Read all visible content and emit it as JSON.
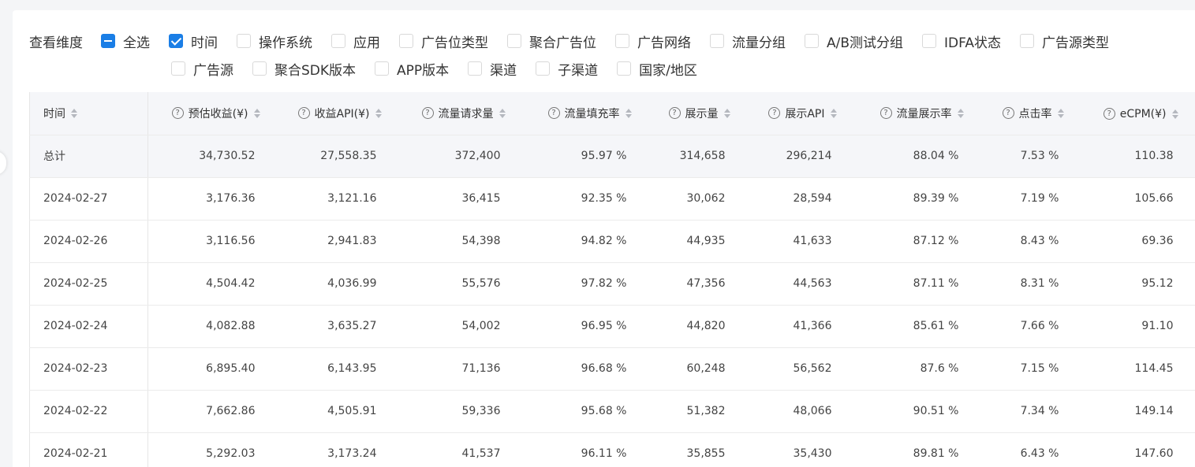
{
  "dimension_selector": {
    "label": "查看维度",
    "row1": [
      {
        "label": "全选",
        "state": "indeterminate"
      },
      {
        "label": "时间",
        "state": "checked"
      },
      {
        "label": "操作系统",
        "state": "unchecked"
      },
      {
        "label": "应用",
        "state": "unchecked"
      },
      {
        "label": "广告位类型",
        "state": "unchecked"
      },
      {
        "label": "聚合广告位",
        "state": "unchecked"
      },
      {
        "label": "广告网络",
        "state": "unchecked"
      },
      {
        "label": "流量分组",
        "state": "unchecked"
      },
      {
        "label": "A/B测试分组",
        "state": "unchecked"
      },
      {
        "label": "IDFA状态",
        "state": "unchecked"
      },
      {
        "label": "广告源类型",
        "state": "unchecked"
      }
    ],
    "row2": [
      {
        "label": "广告源",
        "state": "unchecked"
      },
      {
        "label": "聚合SDK版本",
        "state": "unchecked"
      },
      {
        "label": "APP版本",
        "state": "unchecked"
      },
      {
        "label": "渠道",
        "state": "unchecked"
      },
      {
        "label": "子渠道",
        "state": "unchecked"
      },
      {
        "label": "国家/地区",
        "state": "unchecked"
      }
    ]
  },
  "table": {
    "columns": [
      {
        "label": "时间",
        "help": false
      },
      {
        "label": "预估收益(¥)",
        "help": true
      },
      {
        "label": "收益API(¥)",
        "help": true
      },
      {
        "label": "流量请求量",
        "help": true
      },
      {
        "label": "流量填充率",
        "help": true
      },
      {
        "label": "展示量",
        "help": true
      },
      {
        "label": "展示API",
        "help": true
      },
      {
        "label": "流量展示率",
        "help": true
      },
      {
        "label": "点击率",
        "help": true
      },
      {
        "label": "eCPM(¥)",
        "help": true
      }
    ],
    "total": [
      "总计",
      "34,730.52",
      "27,558.35",
      "372,400",
      "95.97 %",
      "314,658",
      "296,214",
      "88.04 %",
      "7.53 %",
      "110.38"
    ],
    "rows": [
      [
        "2024-02-27",
        "3,176.36",
        "3,121.16",
        "36,415",
        "92.35 %",
        "30,062",
        "28,594",
        "89.39 %",
        "7.19 %",
        "105.66"
      ],
      [
        "2024-02-26",
        "3,116.56",
        "2,941.83",
        "54,398",
        "94.82 %",
        "44,935",
        "41,633",
        "87.12 %",
        "8.43 %",
        "69.36"
      ],
      [
        "2024-02-25",
        "4,504.42",
        "4,036.99",
        "55,576",
        "97.82 %",
        "47,356",
        "44,563",
        "87.11 %",
        "8.31 %",
        "95.12"
      ],
      [
        "2024-02-24",
        "4,082.88",
        "3,635.27",
        "54,002",
        "96.95 %",
        "44,820",
        "41,366",
        "85.61 %",
        "7.66 %",
        "91.10"
      ],
      [
        "2024-02-23",
        "6,895.40",
        "6,143.95",
        "71,136",
        "96.68 %",
        "60,248",
        "56,562",
        "87.6 %",
        "7.15 %",
        "114.45"
      ],
      [
        "2024-02-22",
        "7,662.86",
        "4,505.91",
        "59,336",
        "95.68 %",
        "51,382",
        "48,066",
        "90.51 %",
        "7.34 %",
        "149.14"
      ],
      [
        "2024-02-21",
        "5,292.03",
        "3,173.24",
        "41,537",
        "96.11 %",
        "35,855",
        "35,430",
        "89.81 %",
        "6.43 %",
        "147.60"
      ]
    ]
  },
  "colors": {
    "checkbox_active": "#1a7ee6",
    "header_bg": "#f5f6f9",
    "page_bg": "#f4f5f7"
  }
}
